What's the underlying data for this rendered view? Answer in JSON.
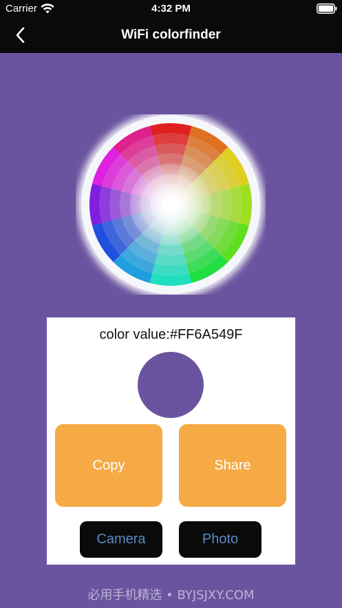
{
  "status_bar": {
    "carrier": "Carrier",
    "time": "4:32 PM"
  },
  "nav": {
    "title": "WiFi colorfinder",
    "back_icon": "chevron-left-icon"
  },
  "picker": {
    "color_label": "color value:#FF6A549F",
    "swatch_color": "#6A549F"
  },
  "buttons": {
    "copy": "Copy",
    "share": "Share",
    "camera": "Camera",
    "photo": "Photo"
  },
  "theme": {
    "background": "#6A549F",
    "accent_orange": "#F5AA45",
    "button_text_blue": "#5A8AC8"
  },
  "watermark": "必用手机精选 • BYJSJXY.COM"
}
